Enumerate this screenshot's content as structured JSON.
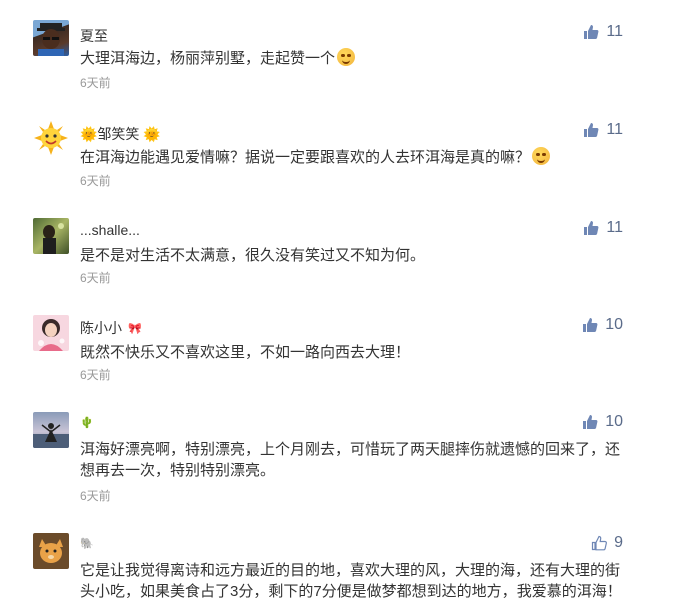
{
  "comments": [
    {
      "name": "夏至",
      "badge": "",
      "text": "大理洱海边，杨丽萍别墅，走起赞一个",
      "emoji": "heart-eyes-emoji",
      "time": "6天前",
      "likes": "11",
      "thumb_filled": true
    },
    {
      "name": "🌞邹笑笑 🌞",
      "badge": "",
      "text": "在洱海边能遇见爱情嘛？据说一定要跟喜欢的人去环洱海是真的嘛？",
      "emoji": "grin-emoji",
      "time": "6天前",
      "likes": "11",
      "thumb_filled": true
    },
    {
      "name": "...shalle...",
      "badge": "",
      "text": "是不是对生活不太满意，很久没有笑过又不知为何。",
      "emoji": "",
      "time": "6天前",
      "likes": "11",
      "thumb_filled": true
    },
    {
      "name": "陈小小",
      "badge": "🎀",
      "text": "既然不快乐又不喜欢这里，不如一路向西去大理！",
      "emoji": "",
      "time": "6天前",
      "likes": "10",
      "thumb_filled": true
    },
    {
      "name": "",
      "badge": "🌵",
      "text": "洱海好漂亮啊，特别漂亮，上个月刚去，可惜玩了两天腿摔伤就遗憾的回来了，还想再去一次，特别特别漂亮。",
      "emoji": "",
      "time": "6天前",
      "likes": "10",
      "thumb_filled": true
    },
    {
      "name": "",
      "badge": "🐘",
      "text": "它是让我觉得离诗和远方最近的目的地，喜欢大理的风，大理的海，还有大理的街头小吃，如果美食占了3分，剩下的7分便是做梦都想到达的地方，我爱慕的洱海！",
      "emoji": "",
      "time": "",
      "likes": "9",
      "thumb_filled": false
    }
  ]
}
